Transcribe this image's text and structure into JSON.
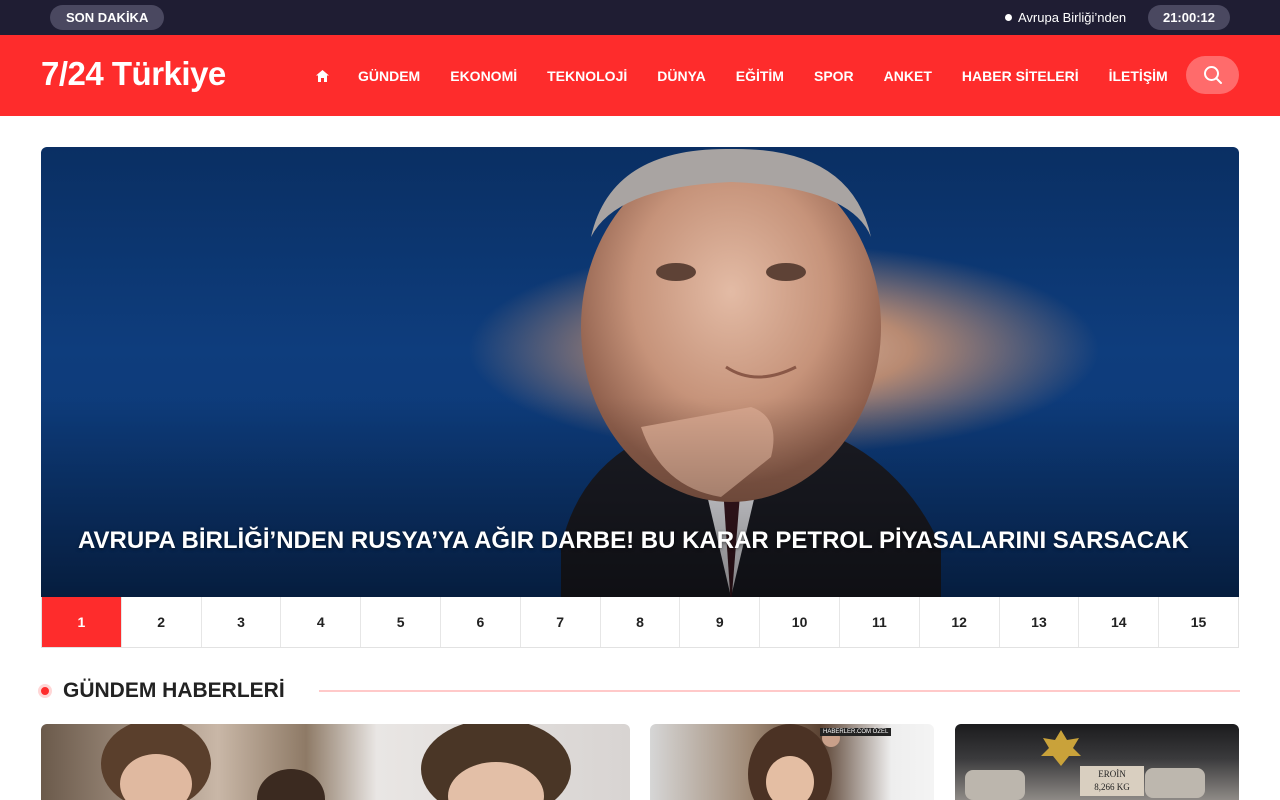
{
  "topbar": {
    "breaking_label": "SON DAKİKA",
    "ticker_text": "Avrupa Birliği’nden",
    "clock": "21:00:12"
  },
  "header": {
    "logo": "7/24 Türkiye",
    "nav": [
      "GÜNDEM",
      "EKONOMİ",
      "TEKNOLOJİ",
      "DÜNYA",
      "EĞİTİM",
      "SPOR",
      "ANKET",
      "HABER SİTELERİ",
      "İLETİŞİM"
    ],
    "icons": {
      "home": "home-icon",
      "search": "search-icon"
    }
  },
  "hero": {
    "headline": "AVRUPA BİRLİĞİ’NDEN RUSYA’YA AĞIR DARBE! BU KARAR PETROL PİYASALARINI SARSACAK",
    "pages": [
      "1",
      "2",
      "3",
      "4",
      "5",
      "6",
      "7",
      "8",
      "9",
      "10",
      "11",
      "12",
      "13",
      "14",
      "15"
    ],
    "active_page": "1"
  },
  "section": {
    "title": "GÜNDEM HABERLERİ"
  },
  "cards": [
    {
      "kind": "photo"
    },
    {
      "kind": "photo",
      "badge": "HABERLER.COM ÖZEL"
    },
    {
      "kind": "photo",
      "label_line1": "EROİN",
      "label_line2": "8,266 KG"
    }
  ],
  "colors": {
    "brand_red": "#fe2c2c",
    "topbar_bg": "#1f1d33",
    "text_dark": "#222222"
  }
}
